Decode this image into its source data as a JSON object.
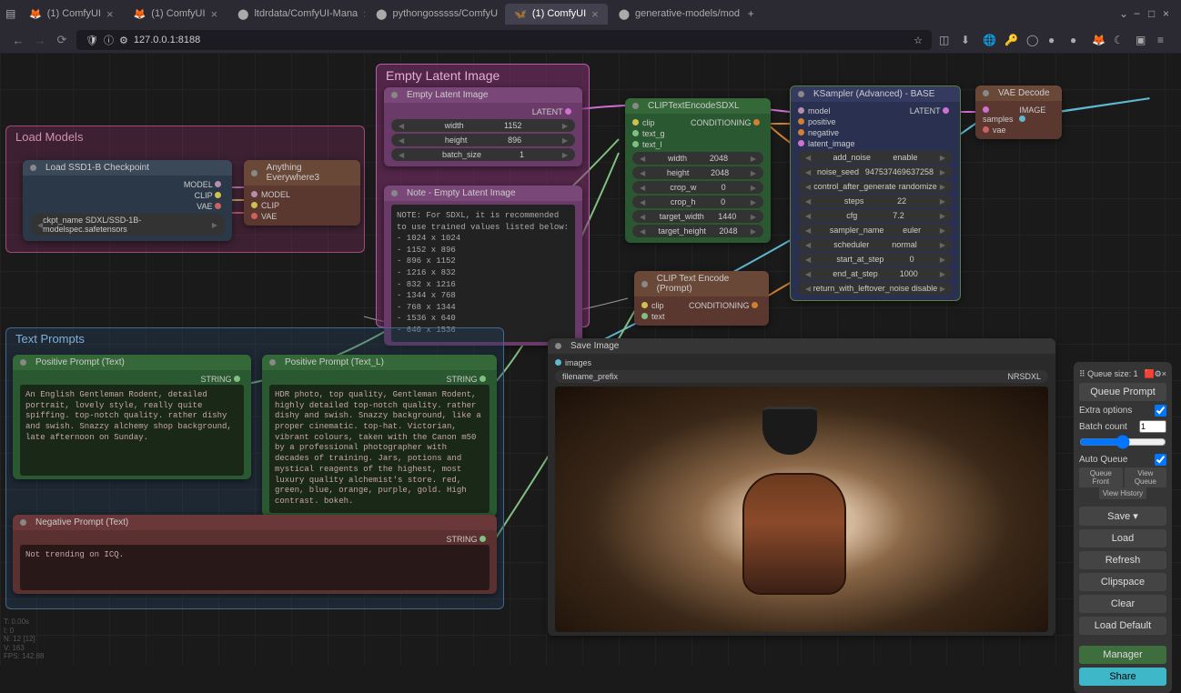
{
  "browser": {
    "tabs": [
      {
        "label": "(1) ComfyUI"
      },
      {
        "label": "(1) ComfyUI"
      },
      {
        "label": "ltdrdata/ComfyUI-Mana"
      },
      {
        "label": "pythongosssss/ComfyU"
      },
      {
        "label": "(1) ComfyUI",
        "active": true
      },
      {
        "label": "generative-models/mod"
      }
    ],
    "url": "127.0.0.1:8188"
  },
  "groups": {
    "load_models": {
      "title": "Load Models"
    },
    "text_prompts": {
      "title": "Text Prompts"
    }
  },
  "nodes": {
    "load_ckpt": {
      "title": "Load SSD1-B Checkpoint",
      "outputs": [
        "MODEL",
        "CLIP",
        "VAE"
      ],
      "ckpt_name": "SDXL/SSD-1B-modelspec.safetensors"
    },
    "anything": {
      "title": "Anything Everywhere3",
      "inputs": [
        "MODEL",
        "CLIP",
        "VAE"
      ]
    },
    "empty_latent_group": {
      "title": "Empty Latent Image"
    },
    "empty_latent": {
      "title": "Empty Latent Image",
      "output": "LATENT",
      "width": {
        "label": "width",
        "value": "1152"
      },
      "height": {
        "label": "height",
        "value": "896"
      },
      "batch": {
        "label": "batch_size",
        "value": "1"
      }
    },
    "note": {
      "title": "Note - Empty Latent Image",
      "text": "NOTE: For SDXL, it is recommended to use trained values listed below:\n - 1024 x 1024\n - 1152 x 896\n - 896  x 1152\n - 1216 x 832\n - 832  x 1216\n - 1344 x 768\n - 768  x 1344\n - 1536 x 640\n - 640  x 1536"
    },
    "clip_sdxl": {
      "title": "CLIPTextEncodeSDXL",
      "inputs": [
        "clip",
        "text_g",
        "text_l"
      ],
      "output": "CONDITIONING",
      "params": [
        {
          "label": "width",
          "value": "2048"
        },
        {
          "label": "height",
          "value": "2048"
        },
        {
          "label": "crop_w",
          "value": "0"
        },
        {
          "label": "crop_h",
          "value": "0"
        },
        {
          "label": "target_width",
          "value": "1440"
        },
        {
          "label": "target_height",
          "value": "2048"
        }
      ]
    },
    "clip_text": {
      "title": "CLIP Text Encode (Prompt)",
      "inputs": [
        "clip",
        "text"
      ],
      "output": "CONDITIONING"
    },
    "ksampler": {
      "title": "KSampler (Advanced) - BASE",
      "inputs": [
        "model",
        "positive",
        "negative",
        "latent_image"
      ],
      "output": "LATENT",
      "params": [
        {
          "label": "add_noise",
          "value": "enable"
        },
        {
          "label": "noise_seed",
          "value": "947537469637258"
        },
        {
          "label": "control_after_generate",
          "value": "randomize"
        },
        {
          "label": "steps",
          "value": "22"
        },
        {
          "label": "cfg",
          "value": "7.2"
        },
        {
          "label": "sampler_name",
          "value": "euler"
        },
        {
          "label": "scheduler",
          "value": "normal"
        },
        {
          "label": "start_at_step",
          "value": "0"
        },
        {
          "label": "end_at_step",
          "value": "1000"
        },
        {
          "label": "return_with_leftover_noise",
          "value": "disable"
        }
      ]
    },
    "vae_decode": {
      "title": "VAE Decode",
      "inputs": [
        "samples",
        "vae"
      ],
      "output": "IMAGE"
    },
    "save_image": {
      "title": "Save Image",
      "input": "images",
      "prefix_label": "filename_prefix",
      "prefix": "NRSDXL"
    },
    "pos_prompt": {
      "title": "Positive Prompt (Text)",
      "output": "STRING",
      "text": "An English Gentleman Rodent, detailed portrait, lovely style, really quite spiffing. top-notch quality. rather dishy and swish. Snazzy alchemy shop background, late afternoon on Sunday."
    },
    "pos_prompt_l": {
      "title": "Positive Prompt (Text_L)",
      "output": "STRING",
      "text": "HDR photo, top quality, Gentleman Rodent, highly detailed top-notch quality. rather dishy and swish. Snazzy background, like a proper cinematic. top-hat. Victorian, vibrant colours, taken with the Canon m50 by a professional photographer with decades of training. Jars, potions and mystical reagents of the highest, most luxury quality alchemist's store. red, green, blue, orange, purple, gold. High contrast. bokeh."
    },
    "neg_prompt": {
      "title": "Negative Prompt (Text)",
      "output": "STRING",
      "text": "Not trending on ICQ."
    }
  },
  "panel": {
    "queue_size_label": "Queue size:",
    "queue_size": "1",
    "queue_prompt": "Queue Prompt",
    "extra_options": "Extra options",
    "batch_count_label": "Batch count",
    "batch_count": "1",
    "auto_queue": "Auto Queue",
    "queue_front": "Queue Front",
    "view_queue": "View Queue",
    "view_history": "View History",
    "save": "Save",
    "load": "Load",
    "refresh": "Refresh",
    "clipspace": "Clipspace",
    "clear": "Clear",
    "load_default": "Load Default",
    "manager": "Manager",
    "share": "Share"
  },
  "stats": {
    "l1": "T: 0.00s",
    "l2": "I: 0",
    "l3": "N: 12 [12]",
    "l4": "V: 163",
    "l5": "FPS: 142.88"
  }
}
